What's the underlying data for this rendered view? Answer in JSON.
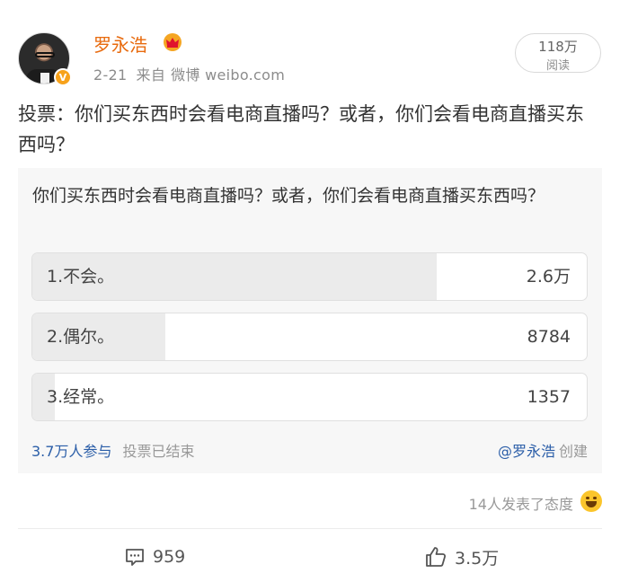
{
  "post": {
    "author": "罗永浩",
    "date": "2-21",
    "source_prefix": "来自",
    "source": "微博 weibo.com",
    "reads_count": "118万",
    "reads_label": "阅读",
    "verified_badge": "V",
    "text": "投票：你们买东西时会看电商直播吗？或者，你们会看电商直播买东西吗？"
  },
  "poll": {
    "question": "你们买东西时会看电商直播吗？或者，你们会看电商直播买东西吗？",
    "options": [
      {
        "label": "1.不会。",
        "count": "2.6万",
        "fraction": 0.73
      },
      {
        "label": "2.偶尔。",
        "count": "8784",
        "fraction": 0.24
      },
      {
        "label": "3.经常。",
        "count": "1357",
        "fraction": 0.04
      }
    ],
    "participants": "3.7万人参与",
    "status": "投票已结束",
    "creator_handle": "@罗永浩",
    "creator_suffix": "创建"
  },
  "reactions": {
    "text": "14人发表了态度",
    "icon": "grin-emoji-icon"
  },
  "actions": {
    "comments": "959",
    "likes": "3.5万"
  },
  "colors": {
    "username": "#e86b0f",
    "link": "#2b5ea8",
    "vip_badge": "#f7a21b"
  }
}
